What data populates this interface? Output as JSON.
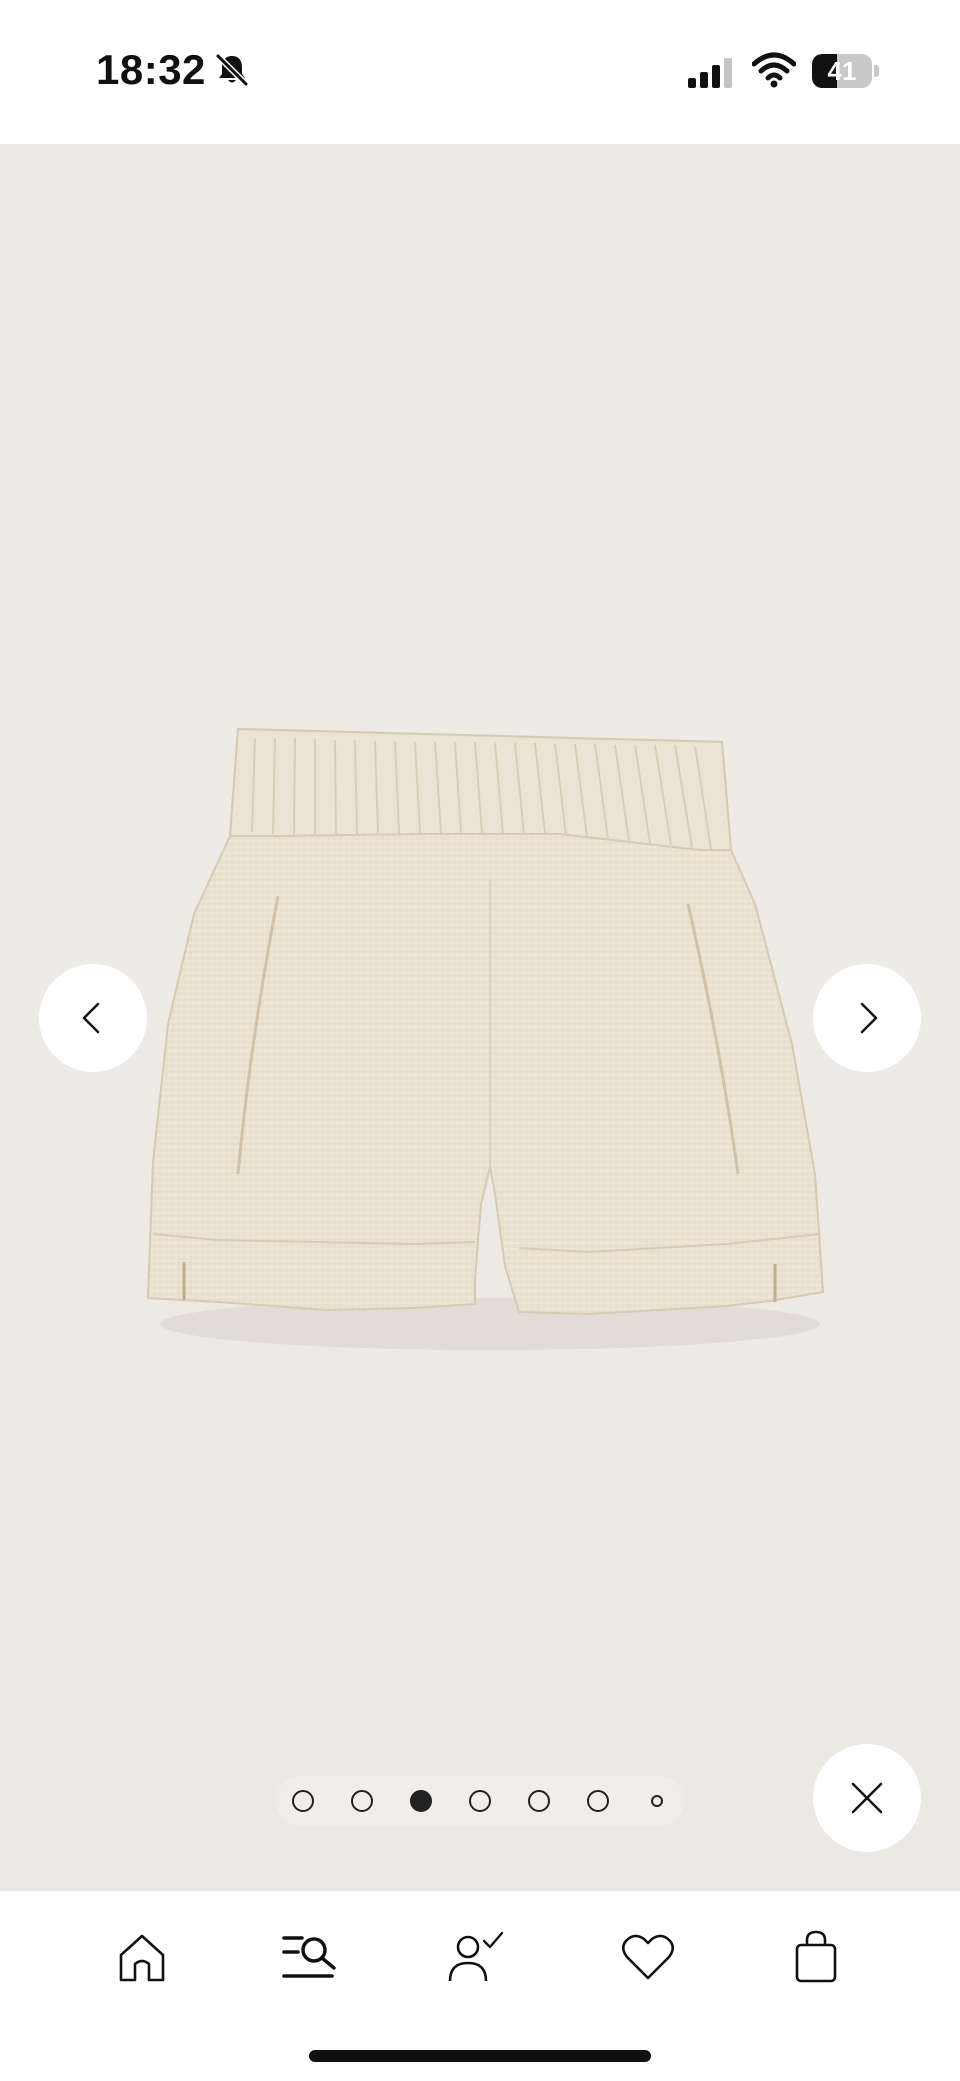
{
  "status_bar": {
    "time": "18:32",
    "battery_level": "41",
    "battery_fraction": 0.41
  },
  "icons": {
    "bell": "bell-slash-icon",
    "signal": "cellular-signal-icon",
    "wifi": "wifi-icon",
    "prev": "chevron-left-icon",
    "next": "chevron-right-icon",
    "close": "close-icon",
    "home": "home-icon",
    "search": "search-icon",
    "account": "account-icon",
    "wishlist": "heart-icon",
    "bag": "shopping-bag-icon"
  },
  "gallery": {
    "image_count": 7,
    "active_index": 3
  },
  "colors": {
    "gallery_background": "#eeeae6",
    "product": "#ece4d4",
    "ink": "#111111"
  }
}
